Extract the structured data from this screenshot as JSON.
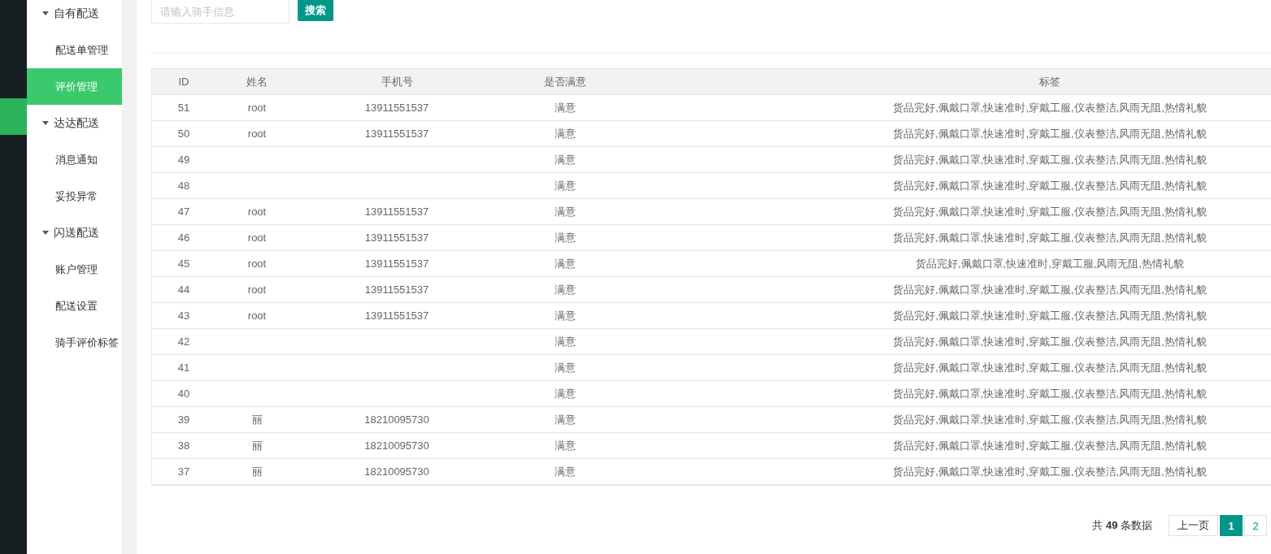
{
  "sidebar": {
    "groups": [
      {
        "label": "自有配送",
        "expanded": true,
        "children": [
          {
            "label": "配送单管理",
            "selected": false
          },
          {
            "label": "评价管理",
            "selected": true
          }
        ]
      },
      {
        "label": "达达配送",
        "expanded": true,
        "children": [
          {
            "label": "消息通知",
            "selected": false
          },
          {
            "label": "妥投异常",
            "selected": false
          }
        ]
      },
      {
        "label": "闪送配送",
        "expanded": true,
        "children": [
          {
            "label": "账户管理",
            "selected": false
          },
          {
            "label": "配送设置",
            "selected": false
          },
          {
            "label": "骑手评价标签",
            "selected": false
          }
        ]
      }
    ]
  },
  "search": {
    "placeholder": "请输入骑手信息",
    "button": "搜索"
  },
  "table": {
    "columns": [
      "ID",
      "姓名",
      "手机号",
      "是否满意",
      "标签"
    ],
    "rows": [
      {
        "id": "51",
        "name": "root",
        "phone": "13911551537",
        "satisfied": "满意",
        "tags": "货品完好,佩戴口罩,快速准时,穿戴工服,仪表整洁,风雨无阻,热情礼貌"
      },
      {
        "id": "50",
        "name": "root",
        "phone": "13911551537",
        "satisfied": "满意",
        "tags": "货品完好,佩戴口罩,快速准时,穿戴工服,仪表整洁,风雨无阻,热情礼貌"
      },
      {
        "id": "49",
        "satisfied": "满意",
        "tags": "货品完好,佩戴口罩,快速准时,穿戴工服,仪表整洁,风雨无阻,热情礼貌"
      },
      {
        "id": "48",
        "satisfied": "满意",
        "tags": "货品完好,佩戴口罩,快速准时,穿戴工服,仪表整洁,风雨无阻,热情礼貌"
      },
      {
        "id": "47",
        "name": "root",
        "phone": "13911551537",
        "satisfied": "满意",
        "tags": "货品完好,佩戴口罩,快速准时,穿戴工服,仪表整洁,风雨无阻,热情礼貌"
      },
      {
        "id": "46",
        "name": "root",
        "phone": "13911551537",
        "satisfied": "满意",
        "tags": "货品完好,佩戴口罩,快速准时,穿戴工服,仪表整洁,风雨无阻,热情礼貌"
      },
      {
        "id": "45",
        "name": "root",
        "phone": "13911551537",
        "satisfied": "满意",
        "tags": "货品完好,佩戴口罩,快速准时,穿戴工服,风雨无阻,热情礼貌"
      },
      {
        "id": "44",
        "name": "root",
        "phone": "13911551537",
        "satisfied": "满意",
        "tags": "货品完好,佩戴口罩,快速准时,穿戴工服,仪表整洁,风雨无阻,热情礼貌"
      },
      {
        "id": "43",
        "name": "root",
        "phone": "13911551537",
        "satisfied": "满意",
        "tags": "货品完好,佩戴口罩,快速准时,穿戴工服,仪表整洁,风雨无阻,热情礼貌"
      },
      {
        "id": "42",
        "satisfied": "满意",
        "tags": "货品完好,佩戴口罩,快速准时,穿戴工服,仪表整洁,风雨无阻,热情礼貌"
      },
      {
        "id": "41",
        "satisfied": "满意",
        "tags": "货品完好,佩戴口罩,快速准时,穿戴工服,仪表整洁,风雨无阻,热情礼貌"
      },
      {
        "id": "40",
        "satisfied": "满意",
        "tags": "货品完好,佩戴口罩,快速准时,穿戴工服,仪表整洁,风雨无阻,热情礼貌"
      },
      {
        "id": "39",
        "name": "丽",
        "phone": "18210095730",
        "satisfied": "满意",
        "tags": "货品完好,佩戴口罩,快速准时,穿戴工服,仪表整洁,风雨无阻,热情礼貌"
      },
      {
        "id": "38",
        "name": "丽",
        "phone": "18210095730",
        "satisfied": "满意",
        "tags": "货品完好,佩戴口罩,快速准时,穿戴工服,仪表整洁,风雨无阻,热情礼貌"
      },
      {
        "id": "37",
        "name": "丽",
        "phone": "18210095730",
        "satisfied": "满意",
        "tags": "货品完好,佩戴口罩,快速准时,穿戴工服,仪表整洁,风雨无阻,热情礼貌"
      }
    ]
  },
  "pagination": {
    "total": "共 **49** 条数据",
    "prev": "上一页",
    "pages": [
      {
        "label": "1",
        "selected": true
      },
      {
        "label": "2",
        "selected": false
      }
    ]
  }
}
